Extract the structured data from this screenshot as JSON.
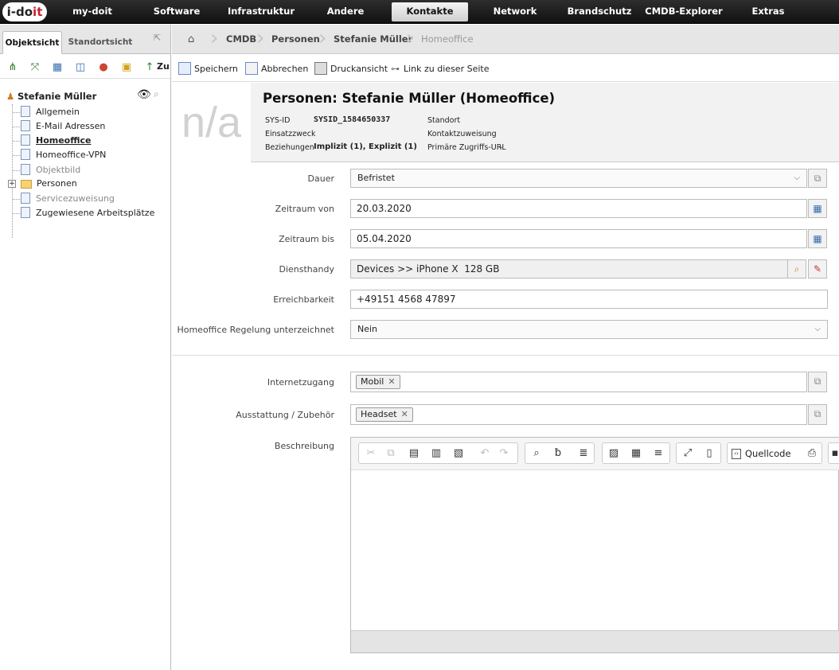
{
  "app": {
    "logo_prefix": "i-do",
    "logo_suffix": "it"
  },
  "nav": {
    "items": [
      "my-doit",
      "Software",
      "Infrastruktur",
      "Andere",
      "Kontakte",
      "Network",
      "Brandschutz",
      "CMDB-Explorer",
      "Extras"
    ],
    "active": "Kontakte"
  },
  "left": {
    "tabs": [
      "Objektsicht",
      "Standortsicht"
    ],
    "toolbar_text": "Zu",
    "tree": {
      "root": "Stefanie Müller",
      "items": [
        "Allgemein",
        "E-Mail Adressen",
        "Homeoffice",
        "Homeoffice-VPN",
        "Objektbild",
        "Personen",
        "Servicezuweisung",
        "Zugewiesene Arbeitsplätze"
      ],
      "active": "Homeoffice"
    }
  },
  "breadcrumb": [
    "CMDB",
    "Personen",
    "Stefanie Müller",
    "Homeoffice"
  ],
  "toolbar": {
    "save": "Speichern",
    "cancel": "Abbrechen",
    "print": "Druckansicht",
    "link": "Link zu dieser Seite"
  },
  "header": {
    "placeholder": "n/a",
    "title": "Personen: Stefanie Müller (Homeoffice)",
    "sysid_label": "SYS-ID",
    "sysid_value": "SYSID_1584650337",
    "einsatz_label": "Einsatzzweck",
    "bez_label": "Beziehungen",
    "bez_value": "Implizit (1), Explizit (1)",
    "standort_label": "Standort",
    "kontakt_label": "Kontaktzuweisung",
    "zugriff_label": "Primäre Zugriffs-URL",
    "zugriff_value": "-"
  },
  "form": {
    "dauer": {
      "label": "Dauer",
      "value": "Befristet"
    },
    "von": {
      "label": "Zeitraum von",
      "value": "20.03.2020"
    },
    "bis": {
      "label": "Zeitraum bis",
      "value": "05.04.2020"
    },
    "handy": {
      "label": "Diensthandy",
      "value": "Devices >> iPhone X  128 GB"
    },
    "erreich": {
      "label": "Erreichbarkeit",
      "value": "+49151 4568 47897"
    },
    "regel": {
      "label": "Homeoffice Regelung unterzeichnet",
      "value": "Nein"
    },
    "internet": {
      "label": "Internetzugang",
      "tag": "Mobil"
    },
    "ausstattung": {
      "label": "Ausstattung / Zubehör",
      "tag": "Headset"
    },
    "beschreibung": {
      "label": "Beschreibung",
      "source_button": "Quellcode"
    }
  }
}
